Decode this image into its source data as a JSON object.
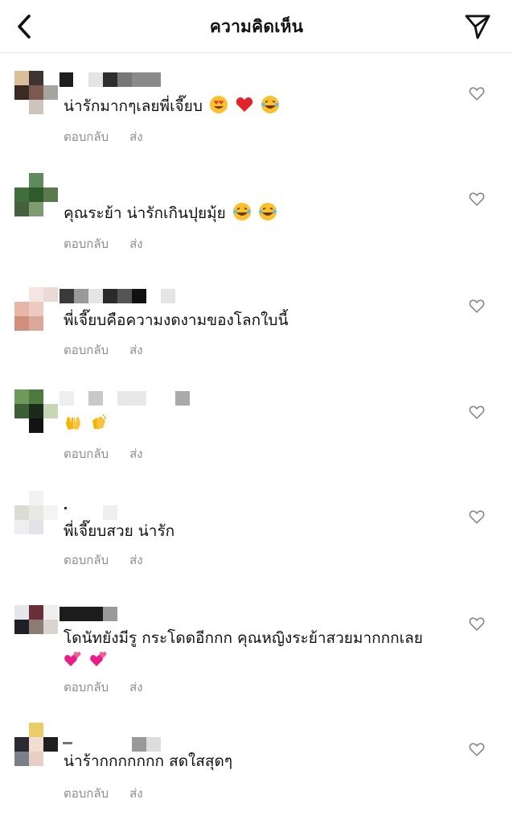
{
  "header": {
    "title": "ความคิดเห็น"
  },
  "comments": [
    {
      "text": "น่ารักมากๆเลยพี่เจี๊ยบ",
      "emojis": [
        "heart-eyes",
        "red-heart",
        "laugh-tears"
      ]
    },
    {
      "text": "คุณระย้า น่ารักเกินปุยมุ้ย",
      "emojis": [
        "laugh-tears",
        "laugh-tears"
      ]
    },
    {
      "text": "พี่เจี๊ยบคือความงดงามของโลกใบนี้",
      "emojis": []
    },
    {
      "text": "",
      "emojis": [
        "raising-hands",
        "clapping-hands"
      ]
    },
    {
      "text": "พี่เจี๊ยบสวย น่ารัก",
      "emojis": []
    },
    {
      "text": "โดนัทยังมีรู กระโดดอีกกก คุณหญิงระย้าสวยมากกกเลย",
      "emojis": [
        "two-hearts",
        "two-hearts"
      ]
    },
    {
      "text": "น่าร้ากกกกกกก สดใสสุดๆ",
      "emojis": []
    }
  ],
  "actions": {
    "reply": "ตอบกลับ",
    "send": "ส่ง"
  }
}
